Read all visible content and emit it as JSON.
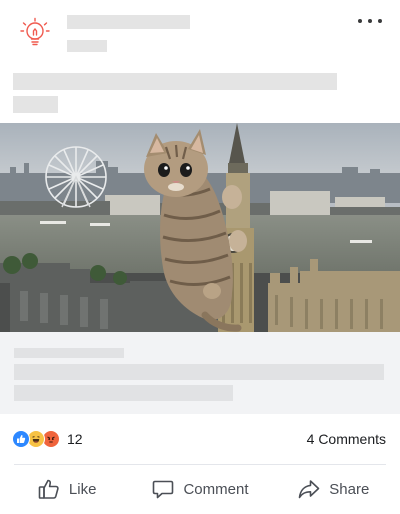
{
  "post": {
    "author_avatar_icon": "lightbulb-idea-icon",
    "more_icon": "more-horizontal-icon"
  },
  "media": {
    "description_icon": "photo"
  },
  "counts": {
    "reaction_icons": [
      "like-reaction-icon",
      "haha-reaction-icon",
      "angry-reaction-icon"
    ],
    "reaction_count": "12",
    "comments": "4 Comments"
  },
  "actions": {
    "like_label": "Like",
    "comment_label": "Comment",
    "share_label": "Share"
  },
  "colors": {
    "accent": "#f0643c",
    "like_blue": "#2d88ff",
    "placeholder": "#e4e4e4",
    "preview_bg": "#f2f3f5"
  }
}
